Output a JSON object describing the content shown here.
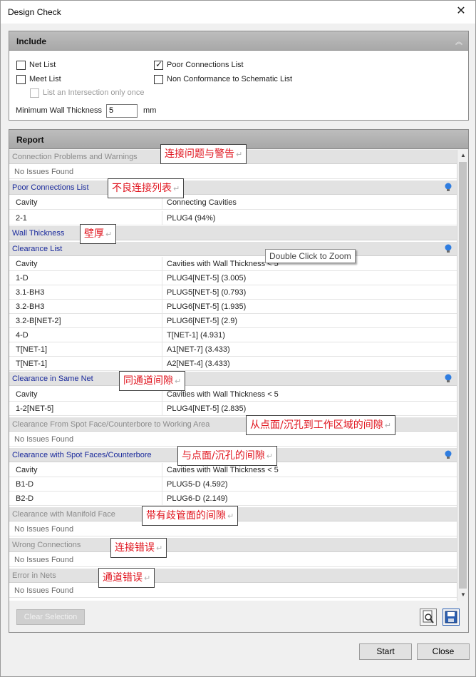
{
  "window": {
    "title": "Design Check",
    "close_glyph": "✕"
  },
  "include": {
    "header": "Include",
    "collapse_glyph": "︽",
    "net_list": "Net List",
    "meet_list": "Meet List",
    "intersection_once": "List an Intersection only once",
    "poor_connections": "Poor Connections List",
    "non_conformance": "Non Conformance to Schematic List",
    "net_list_checked": false,
    "meet_list_checked": false,
    "poor_connections_checked": true,
    "non_conformance_checked": false,
    "min_wall_label": "Minimum Wall Thickness",
    "min_wall_value": "5",
    "min_wall_unit": "mm"
  },
  "report": {
    "header": "Report",
    "rows": [
      "Connection Problems and Warnings",
      "No Issues Found",
      "Poor Connections List",
      [
        "Cavity",
        "Connecting Cavities"
      ],
      [
        "2-1",
        "PLUG4 (94%)"
      ],
      "Wall Thickness",
      "Clearance List",
      [
        "Cavity",
        "Cavities with Wall Thickness < 5"
      ],
      [
        "1-D",
        "PLUG4[NET-5] (3.005)"
      ],
      [
        "3.1-BH3",
        "PLUG5[NET-5] (0.793)"
      ],
      [
        "3.2-BH3",
        "PLUG6[NET-5] (1.935)"
      ],
      [
        "3.2-B[NET-2]",
        "PLUG6[NET-5] (2.9)"
      ],
      [
        "4-D",
        "T[NET-1] (4.931)"
      ],
      [
        "T[NET-1]",
        "A1[NET-7] (3.433)"
      ],
      [
        "T[NET-1]",
        "A2[NET-4] (3.433)"
      ],
      "Clearance in Same Net",
      [
        "Cavity",
        "Cavities with Wall Thickness < 5"
      ],
      [
        "1-2[NET-5]",
        "PLUG4[NET-5] (2.835)"
      ],
      "Clearance From Spot Face/Counterbore to Working Area",
      "No Issues Found",
      "Clearance with Spot Faces/Counterbore",
      [
        "Cavity",
        "Cavities with Wall Thickness < 5"
      ],
      [
        "B1-D",
        "PLUG5-D (4.592)"
      ],
      [
        "B2-D",
        "PLUG6-D (2.149)"
      ],
      "Clearance with Manifold Face",
      "No Issues Found",
      "Wrong Connections",
      "No Issues Found",
      "Error in Nets",
      "No Issues Found"
    ],
    "tooltip": "Double Click to Zoom",
    "clear_selection": "Clear Selection"
  },
  "annotations": {
    "a1": "连接问题与警告",
    "a2": "不良连接列表",
    "a3": "壁厚",
    "a4": "同通道间隙",
    "a5": "从点面/沉孔到工作区域的间隙",
    "a6": "与点面/沉孔的间隙",
    "a7": "带有歧管面的间隙",
    "a8": "连接错误",
    "a9": "通道错误",
    "return_glyph": "↵"
  },
  "buttons": {
    "start": "Start",
    "close": "Close"
  },
  "colors": {
    "section_blue": "#1a2a9c",
    "annotation_red": "#e0141e",
    "bulb_blue": "#2f7de0"
  }
}
